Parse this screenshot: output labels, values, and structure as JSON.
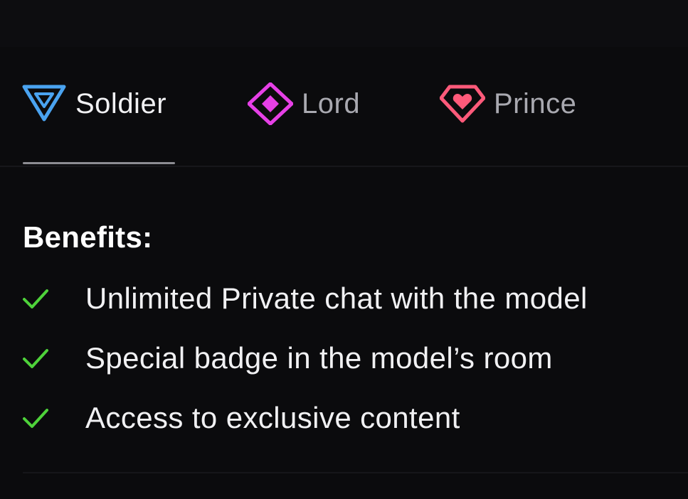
{
  "tabs": [
    {
      "label": "Soldier",
      "icon": "soldier-badge-icon",
      "color": "#4aa3f0",
      "active": true
    },
    {
      "label": "Lord",
      "icon": "lord-badge-icon",
      "color": "#e640e6",
      "active": false
    },
    {
      "label": "Prince",
      "icon": "prince-badge-icon",
      "color": "#ff5a7a",
      "active": false
    }
  ],
  "benefits": {
    "title": "Benefits:",
    "items": [
      {
        "text": "Unlimited Private chat with the model",
        "icon": "check-icon"
      },
      {
        "text": "Special badge in the model’s room",
        "icon": "check-icon"
      },
      {
        "text": "Access to exclusive content",
        "icon": "check-icon"
      }
    ],
    "check_color": "#4ed23a"
  }
}
